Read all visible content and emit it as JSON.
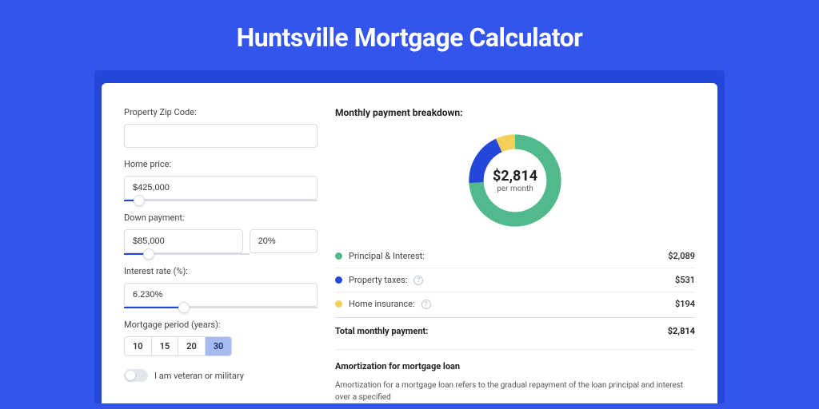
{
  "title": "Huntsville Mortgage Calculator",
  "form": {
    "zip_label": "Property Zip Code:",
    "zip_value": "",
    "home_price_label": "Home price:",
    "home_price_value": "$425,000",
    "home_price_pct": 8,
    "down_label": "Down payment:",
    "down_value": "$85,000",
    "down_pct_value": "20%",
    "down_slider_pct": 20,
    "rate_label": "Interest rate (%):",
    "rate_value": "6.230%",
    "rate_slider_pct": 31,
    "period_label": "Mortgage period (years):",
    "periods": [
      "10",
      "15",
      "20",
      "30"
    ],
    "period_active": "30",
    "veteran_label": "I am veteran or military"
  },
  "breakdown": {
    "heading": "Monthly payment breakdown:",
    "center_value": "$2,814",
    "center_sub": "per month",
    "items": [
      {
        "label": "Principal & Interest:",
        "value": "$2,089",
        "color": "#52B98C",
        "pct": 74,
        "info": false
      },
      {
        "label": "Property taxes:",
        "value": "$531",
        "color": "#2447D8",
        "pct": 19,
        "info": true
      },
      {
        "label": "Home insurance:",
        "value": "$194",
        "color": "#F3CF5B",
        "pct": 7,
        "info": true
      }
    ],
    "total_label": "Total monthly payment:",
    "total_value": "$2,814"
  },
  "amort": {
    "title": "Amortization for mortgage loan",
    "text": "Amortization for a mortgage loan refers to the gradual repayment of the loan principal and interest over a specified"
  },
  "chart_data": {
    "type": "pie",
    "title": "Monthly payment breakdown",
    "series": [
      {
        "name": "Principal & Interest",
        "value": 2089,
        "color": "#52B98C"
      },
      {
        "name": "Property taxes",
        "value": 531,
        "color": "#2447D8"
      },
      {
        "name": "Home insurance",
        "value": 194,
        "color": "#F3CF5B"
      }
    ],
    "total": 2814,
    "center_label": "$2,814 per month"
  }
}
